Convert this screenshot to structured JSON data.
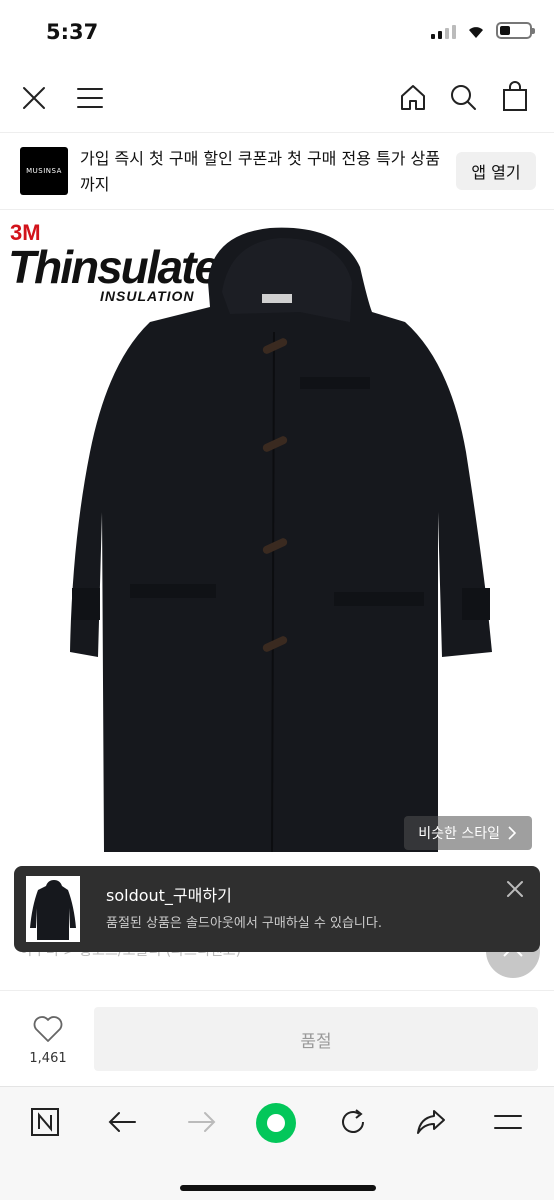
{
  "status": {
    "time": "5:37",
    "battery_level": 0.35
  },
  "nav": {
    "icons": [
      "close-icon",
      "menu-icon",
      "home-icon",
      "search-icon",
      "shopping-bag-icon"
    ]
  },
  "banner": {
    "logo": "MUSINSA",
    "text": "가입 즉시 첫 구매 할인 쿠폰과 첫 구매 전용 특가 상품 까지",
    "button": "앱 열기"
  },
  "product": {
    "brand_3m": "3M",
    "brand_name": "Thinsulate",
    "brand_sub": "INSULATION",
    "similar_style": "비슷한 스타일"
  },
  "toast": {
    "title": "soldout_구매하기",
    "body": "품절된 상품은 솔드아웃에서 구매하실 수 있습니다."
  },
  "underlay_text": "아우터 > 롱코트/오블리 (파드리앤코)",
  "action": {
    "like_count": "1,461",
    "soldout_label": "품절"
  },
  "browser": {
    "icons": [
      "naver-icon",
      "back-icon",
      "forward-icon",
      "green-dot-icon",
      "reload-icon",
      "share-icon",
      "menu-icon"
    ]
  },
  "colors": {
    "toast_bg": "#2f2f2f",
    "naver_green": "#03c75a",
    "brand_red": "#d2131b"
  }
}
